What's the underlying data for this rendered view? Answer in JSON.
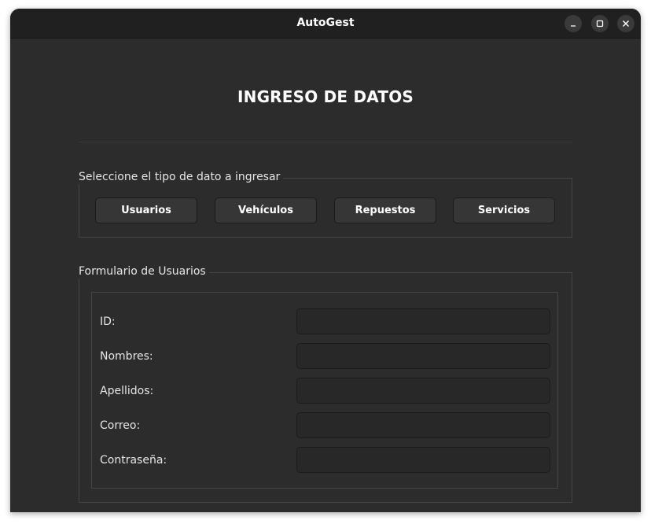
{
  "window": {
    "title": "AutoGest"
  },
  "page": {
    "heading": "INGRESO DE DATOS"
  },
  "type_selector": {
    "label": "Seleccione el tipo de dato a ingresar",
    "buttons": [
      "Usuarios",
      "Vehículos",
      "Repuestos",
      "Servicios"
    ]
  },
  "form": {
    "title": "Formulario de Usuarios",
    "fields": [
      {
        "label": "ID:",
        "value": ""
      },
      {
        "label": "Nombres:",
        "value": ""
      },
      {
        "label": "Apellidos:",
        "value": ""
      },
      {
        "label": "Correo:",
        "value": ""
      },
      {
        "label": "Contraseña:",
        "value": ""
      }
    ]
  },
  "icons": {
    "minimize": "minimize-icon",
    "maximize": "maximize-icon",
    "close": "close-icon"
  },
  "colors": {
    "window_bg": "#2c2c2c",
    "titlebar_bg": "#202020",
    "button_bg": "#363636",
    "input_bg": "#282828",
    "text": "#ffffff"
  }
}
